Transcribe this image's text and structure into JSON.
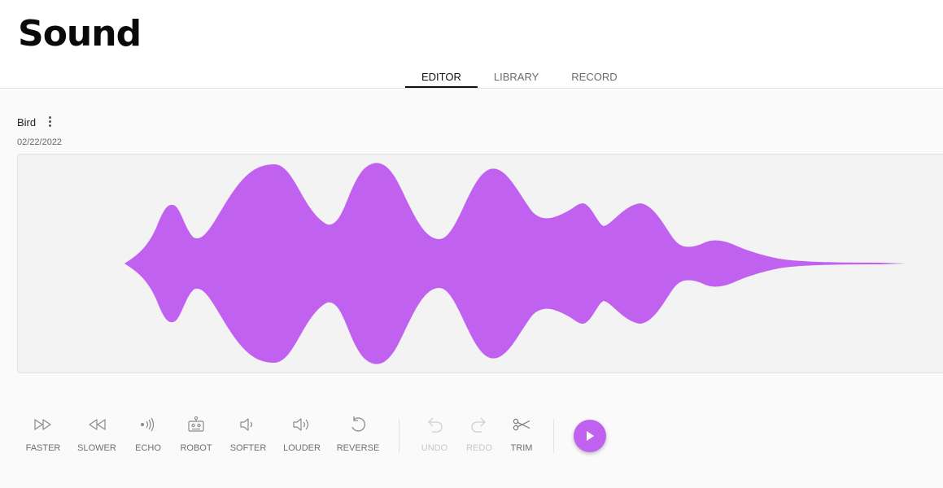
{
  "header": {
    "title": "Sound",
    "tabs": [
      {
        "label": "EDITOR",
        "active": true
      },
      {
        "label": "LIBRARY",
        "active": false
      },
      {
        "label": "RECORD",
        "active": false
      }
    ]
  },
  "sound": {
    "name": "Bird",
    "date": "02/22/2022",
    "waveform_color": "#c161ef"
  },
  "toolbar": {
    "effects": [
      {
        "label": "FASTER",
        "icon": "fast-forward-icon"
      },
      {
        "label": "SLOWER",
        "icon": "rewind-icon"
      },
      {
        "label": "ECHO",
        "icon": "echo-icon"
      },
      {
        "label": "ROBOT",
        "icon": "robot-icon"
      },
      {
        "label": "SOFTER",
        "icon": "volume-low-icon"
      },
      {
        "label": "LOUDER",
        "icon": "volume-high-icon"
      },
      {
        "label": "REVERSE",
        "icon": "reverse-icon"
      }
    ],
    "history": [
      {
        "label": "UNDO",
        "icon": "undo-icon",
        "disabled": true
      },
      {
        "label": "REDO",
        "icon": "redo-icon",
        "disabled": true
      },
      {
        "label": "TRIM",
        "icon": "scissors-icon",
        "disabled": false
      }
    ],
    "play_icon": "play-icon",
    "accent_color": "#c161ef"
  }
}
